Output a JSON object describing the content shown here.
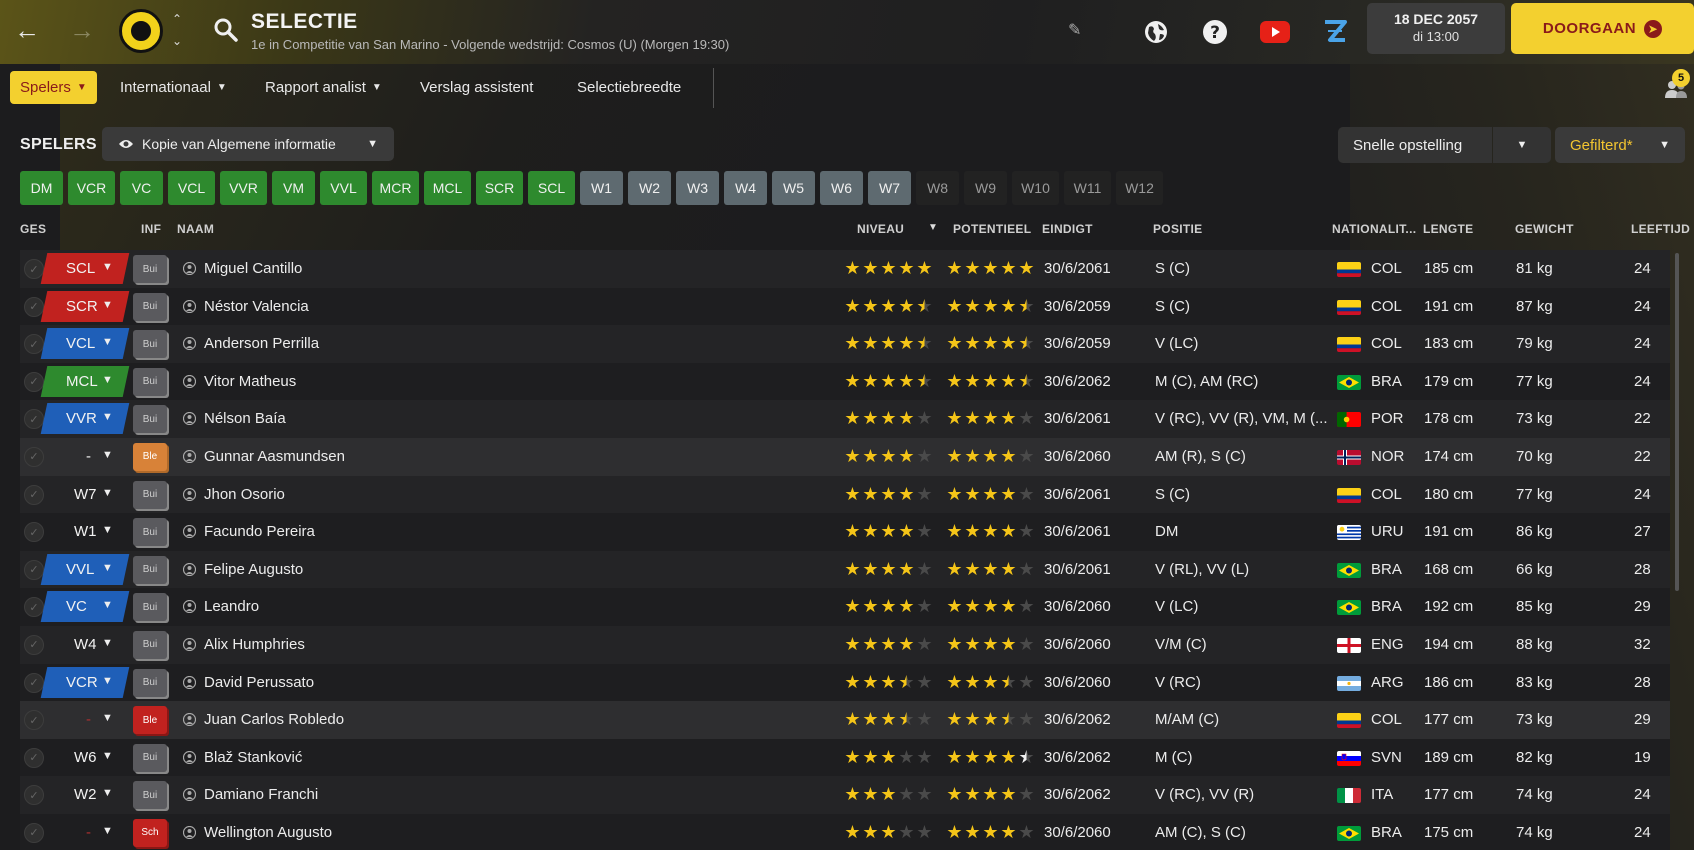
{
  "header": {
    "title": "SELECTIE",
    "subtitle": "1e in Competitie van San Marino - Volgende wedstrijd: Cosmos (U) (Morgen 19:30)",
    "date": "18 DEC 2057",
    "time": "di 13:00",
    "continue_label": "DOORGAAN",
    "icons": [
      "back-icon",
      "forward-icon",
      "club-logo",
      "search-icon",
      "pencil-icon",
      "globe-icon",
      "help-icon",
      "youtube-icon",
      "z-logo-icon"
    ]
  },
  "menu": {
    "items": [
      "Spelers",
      "Internationaal",
      "Rapport analist",
      "Verslag assistent",
      "Selectiebreedte"
    ],
    "notification_count": "5"
  },
  "section": {
    "title": "SPELERS",
    "view": "Kopie van Algemene informatie",
    "quick_lineup": "Snelle opstelling",
    "filter": "Gefilterd*"
  },
  "chips": [
    {
      "label": "DM",
      "style": "green"
    },
    {
      "label": "VCR",
      "style": "green"
    },
    {
      "label": "VC",
      "style": "green"
    },
    {
      "label": "VCL",
      "style": "green"
    },
    {
      "label": "VVR",
      "style": "green"
    },
    {
      "label": "VM",
      "style": "green"
    },
    {
      "label": "VVL",
      "style": "green"
    },
    {
      "label": "MCR",
      "style": "green"
    },
    {
      "label": "MCL",
      "style": "green"
    },
    {
      "label": "SCR",
      "style": "green"
    },
    {
      "label": "SCL",
      "style": "green"
    },
    {
      "label": "W1",
      "style": "grey"
    },
    {
      "label": "W2",
      "style": "grey"
    },
    {
      "label": "W3",
      "style": "grey"
    },
    {
      "label": "W4",
      "style": "grey"
    },
    {
      "label": "W5",
      "style": "grey"
    },
    {
      "label": "W6",
      "style": "grey"
    },
    {
      "label": "W7",
      "style": "grey"
    },
    {
      "label": "W8",
      "style": "dark"
    },
    {
      "label": "W9",
      "style": "dark"
    },
    {
      "label": "W10",
      "style": "dark"
    },
    {
      "label": "W11",
      "style": "dark"
    },
    {
      "label": "W12",
      "style": "dark"
    }
  ],
  "columns": {
    "ges": "GES",
    "inf": "INF",
    "naam": "NAAM",
    "niveau": "NIVEAU",
    "potentieel": "POTENTIEEL",
    "eindigt": "EINDIGT",
    "positie": "POSITIE",
    "nationaliteit": "NATIONALIT...",
    "lengte": "LENGTE",
    "gewicht": "GEWICHT",
    "leeftijd": "LEEFTIJD"
  },
  "colors": {
    "accent": "#f3d02f",
    "pos_red": "#c1221f",
    "pos_blue": "#1f5fb8",
    "pos_green": "#2e8a2e",
    "star": "#f5c518"
  },
  "players": [
    {
      "ges": "SCL",
      "ges_style": "red",
      "inf": "Bui",
      "inf_style": "bui",
      "name": "Miguel Cantillo",
      "level": 5,
      "potential": 5,
      "contract": "30/6/2061",
      "position": "S (C)",
      "flag": "COL",
      "nat": "COL",
      "height": "185 cm",
      "weight": "81 kg",
      "age": "24"
    },
    {
      "ges": "SCR",
      "ges_style": "red",
      "inf": "Bui",
      "inf_style": "bui",
      "name": "Néstor Valencia",
      "level": 4.5,
      "potential": 4.5,
      "contract": "30/6/2059",
      "position": "S (C)",
      "flag": "COL",
      "nat": "COL",
      "height": "191 cm",
      "weight": "87 kg",
      "age": "24"
    },
    {
      "ges": "VCL",
      "ges_style": "blue",
      "inf": "Bui",
      "inf_style": "bui",
      "name": "Anderson Perrilla",
      "level": 4.5,
      "potential": 4.5,
      "contract": "30/6/2059",
      "position": "V (LC)",
      "flag": "COL",
      "nat": "COL",
      "height": "183 cm",
      "weight": "79 kg",
      "age": "24"
    },
    {
      "ges": "MCL",
      "ges_style": "green",
      "inf": "Bui",
      "inf_style": "bui",
      "name": "Vitor Matheus",
      "level": 4.5,
      "potential": 4.5,
      "contract": "30/6/2062",
      "position": "M (C), AM (RC)",
      "flag": "BRA",
      "nat": "BRA",
      "height": "179 cm",
      "weight": "77 kg",
      "age": "24"
    },
    {
      "ges": "VVR",
      "ges_style": "blue",
      "inf": "Bui",
      "inf_style": "bui",
      "name": "Nélson Baía",
      "level": 4,
      "potential": 4,
      "contract": "30/6/2061",
      "position": "V (RC), VV (R), VM, M (...",
      "flag": "POR",
      "nat": "POR",
      "height": "178 cm",
      "weight": "73 kg",
      "age": "22"
    },
    {
      "ges": "-",
      "ges_style": "none",
      "inf": "Ble",
      "inf_style": "ble-o",
      "name": "Gunnar Aasmundsen",
      "level": 4,
      "potential": 4,
      "contract": "30/6/2060",
      "position": "AM (R), S (C)",
      "flag": "NOR",
      "nat": "NOR",
      "height": "174 cm",
      "weight": "70 kg",
      "age": "22"
    },
    {
      "ges": "W7",
      "ges_style": "none",
      "inf": "Bui",
      "inf_style": "bui",
      "name": "Jhon Osorio",
      "level": 4,
      "potential": 4,
      "contract": "30/6/2061",
      "position": "S (C)",
      "flag": "COL",
      "nat": "COL",
      "height": "180 cm",
      "weight": "77 kg",
      "age": "24"
    },
    {
      "ges": "W1",
      "ges_style": "none",
      "inf": "Bui",
      "inf_style": "bui",
      "name": "Facundo Pereira",
      "level": 4,
      "potential": 4,
      "contract": "30/6/2061",
      "position": "DM",
      "flag": "URU",
      "nat": "URU",
      "height": "191 cm",
      "weight": "86 kg",
      "age": "27"
    },
    {
      "ges": "VVL",
      "ges_style": "blue",
      "inf": "Bui",
      "inf_style": "bui",
      "name": "Felipe Augusto",
      "level": 4,
      "potential": 4,
      "contract": "30/6/2061",
      "position": "V (RL), VV (L)",
      "flag": "BRA",
      "nat": "BRA",
      "height": "168 cm",
      "weight": "66 kg",
      "age": "28"
    },
    {
      "ges": "VC",
      "ges_style": "blue",
      "inf": "Bui",
      "inf_style": "bui",
      "name": "Leandro",
      "level": 4,
      "potential": 4,
      "contract": "30/6/2060",
      "position": "V (LC)",
      "flag": "BRA",
      "nat": "BRA",
      "height": "192 cm",
      "weight": "85 kg",
      "age": "29"
    },
    {
      "ges": "W4",
      "ges_style": "none",
      "inf": "Bui",
      "inf_style": "bui",
      "name": "Alix Humphries",
      "level": 4,
      "potential": 4,
      "contract": "30/6/2060",
      "position": "V/M (C)",
      "flag": "ENG",
      "nat": "ENG",
      "height": "194 cm",
      "weight": "88 kg",
      "age": "32"
    },
    {
      "ges": "VCR",
      "ges_style": "blue",
      "inf": "Bui",
      "inf_style": "bui",
      "name": "David Perussato",
      "level": 3.5,
      "potential": 3.5,
      "contract": "30/6/2060",
      "position": "V (RC)",
      "flag": "ARG",
      "nat": "ARG",
      "height": "186 cm",
      "weight": "83 kg",
      "age": "28"
    },
    {
      "ges": "-",
      "ges_style": "none-dim",
      "inf": "Ble",
      "inf_style": "ble-r",
      "name": "Juan Carlos Robledo",
      "level": 3.5,
      "potential": 3.5,
      "contract": "30/6/2062",
      "position": "M/AM (C)",
      "flag": "COL",
      "nat": "COL",
      "height": "177 cm",
      "weight": "73 kg",
      "age": "29"
    },
    {
      "ges": "W6",
      "ges_style": "none",
      "inf": "Bui",
      "inf_style": "bui",
      "name": "Blaž Stanković",
      "level": 3,
      "potential": 4.5,
      "potential_white": true,
      "contract": "30/6/2062",
      "position": "M (C)",
      "flag": "SVN",
      "nat": "SVN",
      "height": "189 cm",
      "weight": "82 kg",
      "age": "19"
    },
    {
      "ges": "W2",
      "ges_style": "none",
      "inf": "Bui",
      "inf_style": "bui",
      "name": "Damiano Franchi",
      "level": 3,
      "potential": 4,
      "contract": "30/6/2062",
      "position": "V (RC), VV (R)",
      "flag": "ITA",
      "nat": "ITA",
      "height": "177 cm",
      "weight": "74 kg",
      "age": "24"
    },
    {
      "ges": "-",
      "ges_style": "none-dim",
      "inf": "Sch",
      "inf_style": "sch",
      "name": "Wellington Augusto",
      "level": 3,
      "potential": 4,
      "contract": "30/6/2060",
      "position": "AM (C), S (C)",
      "flag": "BRA",
      "nat": "BRA",
      "height": "175 cm",
      "weight": "74 kg",
      "age": "24"
    }
  ]
}
